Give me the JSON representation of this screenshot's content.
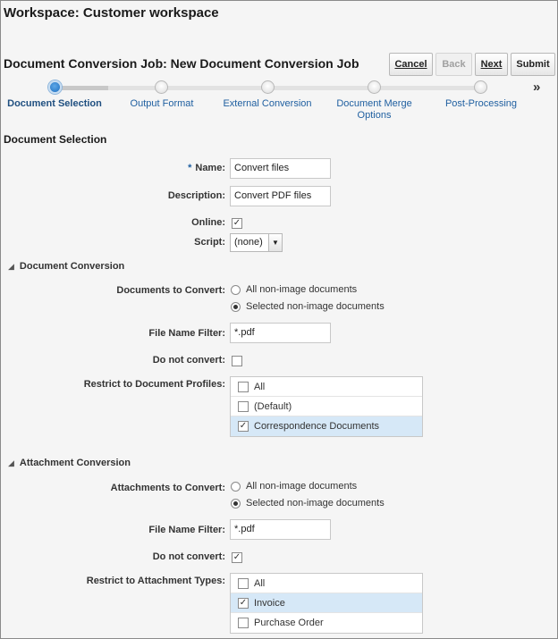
{
  "workspace_title": "Workspace: Customer workspace",
  "job_title": "Document Conversion Job: New Document Conversion Job",
  "buttons": {
    "cancel": "Cancel",
    "back": "Back",
    "next": "Next",
    "submit": "Submit"
  },
  "train": {
    "steps": [
      {
        "label": "Document Selection",
        "active": true
      },
      {
        "label": "Output Format",
        "active": false
      },
      {
        "label": "External Conversion",
        "active": false
      },
      {
        "label": "Document Merge Options",
        "active": false
      },
      {
        "label": "Post-Processing",
        "active": false
      }
    ],
    "more_glyph": "»"
  },
  "section_title": "Document Selection",
  "form": {
    "name_required_mark": "*",
    "name_label": "Name:",
    "name_value": "Convert files",
    "description_label": "Description:",
    "description_value": "Convert PDF files",
    "online_label": "Online:",
    "online_checked": true,
    "script_label": "Script:",
    "script_value": "(none)"
  },
  "document_conversion": {
    "title": "Document Conversion",
    "docs_to_convert_label": "Documents to Convert:",
    "options": [
      "All non-image documents",
      "Selected non-image documents"
    ],
    "selected_option": 1,
    "file_filter_label": "File Name Filter:",
    "file_filter_value": "*.pdf",
    "do_not_convert_label": "Do not convert:",
    "do_not_convert_checked": false,
    "restrict_label": "Restrict to Document Profiles:",
    "profiles": [
      {
        "label": "All",
        "checked": false
      },
      {
        "label": "(Default)",
        "checked": false
      },
      {
        "label": "Correspondence Documents",
        "checked": true
      }
    ]
  },
  "attachment_conversion": {
    "title": "Attachment Conversion",
    "atts_to_convert_label": "Attachments to Convert:",
    "options": [
      "All non-image documents",
      "Selected non-image documents"
    ],
    "selected_option": 1,
    "file_filter_label": "File Name Filter:",
    "file_filter_value": "*.pdf",
    "do_not_convert_label": "Do not convert:",
    "do_not_convert_checked": true,
    "restrict_label": "Restrict to Attachment Types:",
    "types": [
      {
        "label": "All",
        "checked": false
      },
      {
        "label": "Invoice",
        "checked": true
      },
      {
        "label": "Purchase Order",
        "checked": false
      }
    ]
  },
  "icons": {
    "check": "✓",
    "dropdown": "▼",
    "collapse": "◢"
  }
}
